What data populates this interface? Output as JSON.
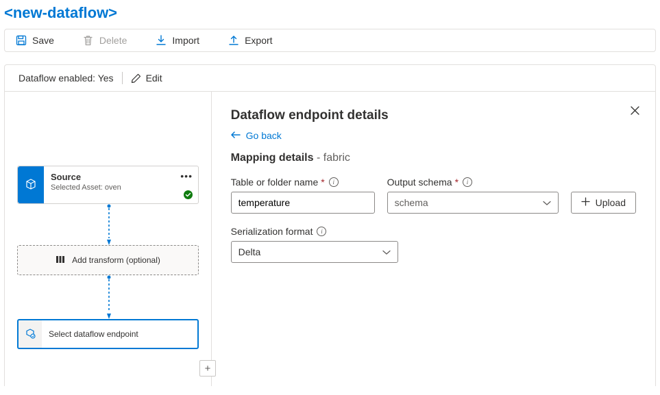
{
  "title": "<new-dataflow>",
  "toolbar": {
    "save": "Save",
    "delete": "Delete",
    "import": "Import",
    "export": "Export"
  },
  "status": {
    "enabled_label": "Dataflow enabled: Yes",
    "edit": "Edit"
  },
  "canvas": {
    "source": {
      "title": "Source",
      "subtitle": "Selected Asset: oven"
    },
    "transform": "Add transform (optional)",
    "endpoint": "Select dataflow endpoint"
  },
  "detail": {
    "heading": "Dataflow endpoint details",
    "go_back": "Go back",
    "section_title": "Mapping details",
    "section_sub": "fabric",
    "table_label": "Table or folder name",
    "table_value": "temperature",
    "output_label": "Output schema",
    "output_placeholder": "schema",
    "upload": "Upload",
    "serial_label": "Serialization format",
    "serial_value": "Delta"
  }
}
